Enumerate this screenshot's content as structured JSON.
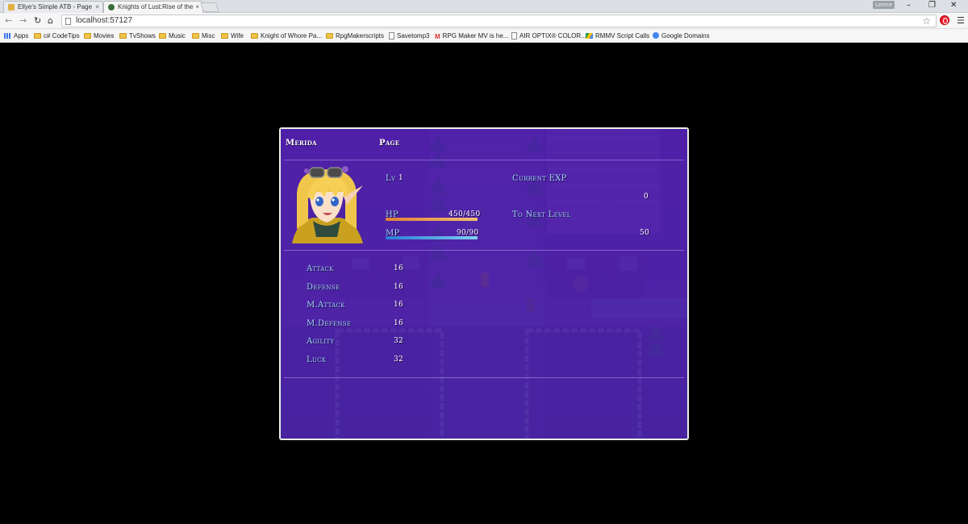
{
  "browser": {
    "tabs": [
      {
        "label": "Ellye's Simple ATB - Page",
        "active": false
      },
      {
        "label": "Knights of Lust:Rise of the",
        "active": true
      }
    ],
    "user_badge": "Leone",
    "url": "localhost:57127",
    "bookmarks": [
      {
        "label": "Apps",
        "icon": "apps-icon"
      },
      {
        "label": "c# CodeTips",
        "icon": "folder-icon"
      },
      {
        "label": "Movies",
        "icon": "folder-icon"
      },
      {
        "label": "TvShows",
        "icon": "folder-icon"
      },
      {
        "label": "Music",
        "icon": "folder-icon"
      },
      {
        "label": "Misc",
        "icon": "folder-icon"
      },
      {
        "label": "Wife",
        "icon": "folder-icon"
      },
      {
        "label": "Knight of Whore Pa...",
        "icon": "folder-icon"
      },
      {
        "label": "RpgMakerscripts",
        "icon": "folder-icon"
      },
      {
        "label": "Savetomp3",
        "icon": "page-icon"
      },
      {
        "label": "RPG Maker MV is he...",
        "icon": "gmail-icon"
      },
      {
        "label": "AIR OPTIX® COLOR...",
        "icon": "page-icon"
      },
      {
        "label": "RMMV Script Calls",
        "icon": "drive-icon"
      },
      {
        "label": "Google Domains",
        "icon": "google-domains-icon"
      }
    ],
    "colors": {
      "tab_bar": "#dcdfe4",
      "toolbar": "#f6f6f6"
    }
  },
  "game": {
    "status": {
      "actor_name": "Merida",
      "actor_class": "Page",
      "level_label": "Lv",
      "level": "1",
      "hp_label": "HP",
      "hp_value": "450/450",
      "hp_ratio": 1.0,
      "mp_label": "MP",
      "mp_value": "90/90",
      "mp_ratio": 1.0,
      "current_exp_label": "Current EXP",
      "current_exp": "0",
      "next_level_label": "To Next Level",
      "next_level": "50",
      "params": [
        {
          "label": "Attack",
          "value": "16"
        },
        {
          "label": "Defense",
          "value": "16"
        },
        {
          "label": "M.Attack",
          "value": "16"
        },
        {
          "label": "M.Defense",
          "value": "16"
        },
        {
          "label": "Agility",
          "value": "32"
        },
        {
          "label": "Luck",
          "value": "32"
        }
      ]
    },
    "colors": {
      "window_bg": "#4b1f9c",
      "system_text": "#9fd7f5",
      "hp_gauge": [
        "#e0803a",
        "#f0c070"
      ],
      "mp_gauge": [
        "#2f7bd6",
        "#7fd0f0"
      ]
    }
  }
}
